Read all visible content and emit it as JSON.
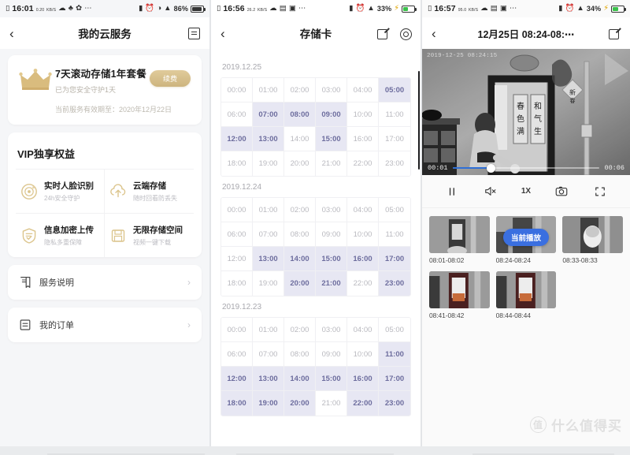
{
  "panels": [
    {
      "id": "cloud-service",
      "status": {
        "time": "16:01",
        "net_top": "0.20",
        "net_bot": "KB/S",
        "battery_pct": "86%",
        "icons": [
          "alarm-icon",
          "dnd-icon",
          "wifi-icon"
        ]
      },
      "nav": {
        "back": "‹",
        "title": "我的云服务",
        "right_icon": "list-box-icon"
      },
      "plan": {
        "title": "7天滚动存储1年套餐",
        "subtitle": "已为您安全守护1天",
        "renew_label": "续费",
        "expire": "当前服务有效期至：2020年12月22日",
        "accent": "#cdb47e"
      },
      "vip": {
        "title": "VIP独享权益",
        "items": [
          {
            "icon": "face-recognition-icon",
            "title": "实时人脸识别",
            "sub": "24h安全守护"
          },
          {
            "icon": "cloud-upload-icon",
            "title": "云端存储",
            "sub": "随时回看防丢失"
          },
          {
            "icon": "shield-check-icon",
            "title": "信息加密上传",
            "sub": "隐私多重保障"
          },
          {
            "icon": "storage-card-icon",
            "title": "无限存储空间",
            "sub": "视频一键下载"
          }
        ]
      },
      "rows": [
        {
          "icon": "document-icon",
          "label": "服务说明",
          "chevron": "›"
        },
        {
          "icon": "order-icon",
          "label": "我的订单",
          "chevron": "›"
        }
      ]
    },
    {
      "id": "storage-card",
      "status": {
        "time": "16:56",
        "net_top": "26.2",
        "net_bot": "KB/S",
        "battery_pct": "33%",
        "icons": [
          "alarm-icon",
          "wifi-icon",
          "charging-icon"
        ]
      },
      "nav": {
        "back": "‹",
        "title": "存储卡",
        "right_icons": [
          "edit-icon",
          "gear-icon"
        ]
      },
      "hour_labels": [
        "00:00",
        "01:00",
        "02:00",
        "03:00",
        "04:00",
        "05:00",
        "06:00",
        "07:00",
        "08:00",
        "09:00",
        "10:00",
        "11:00",
        "12:00",
        "13:00",
        "14:00",
        "15:00",
        "16:00",
        "17:00",
        "18:00",
        "19:00",
        "20:00",
        "21:00",
        "22:00",
        "23:00"
      ],
      "days": [
        {
          "date": "2019.12.25",
          "active_hours": [
            "05:00",
            "07:00",
            "08:00",
            "09:00",
            "12:00",
            "13:00",
            "15:00"
          ]
        },
        {
          "date": "2019.12.24",
          "active_hours": [
            "13:00",
            "14:00",
            "15:00",
            "16:00",
            "17:00",
            "20:00",
            "21:00",
            "23:00"
          ]
        },
        {
          "date": "2019.12.23",
          "active_hours": [
            "11:00",
            "12:00",
            "13:00",
            "14:00",
            "15:00",
            "16:00",
            "17:00",
            "18:00",
            "19:00",
            "20:00",
            "22:00",
            "23:00"
          ]
        }
      ],
      "colors": {
        "active_bg": "#e7e7f3",
        "active_text": "#6d6d9e",
        "idle_text": "#b9b9bf"
      }
    },
    {
      "id": "playback",
      "status": {
        "time": "16:57",
        "net_top": "95.0",
        "net_bot": "KB/S",
        "battery_pct": "34%",
        "icons": [
          "alarm-icon",
          "wifi-icon",
          "charging-icon"
        ]
      },
      "nav": {
        "back": "‹",
        "title": "12月25日 08:24-08:⋯",
        "right_icon": "edit-icon"
      },
      "video": {
        "overlay_timestamp": "2019-12-25 08:24:15",
        "current_time": "00:01",
        "total_time": "00:06",
        "progress_pct": 26
      },
      "controls": [
        {
          "icon": "pause-icon",
          "label": ""
        },
        {
          "icon": "mute-icon",
          "label": ""
        },
        {
          "icon": "speed-icon",
          "label": "1X"
        },
        {
          "icon": "snapshot-icon",
          "label": ""
        },
        {
          "icon": "fullscreen-icon",
          "label": ""
        }
      ],
      "clips": [
        {
          "time": "08:01-08:02",
          "playing": false
        },
        {
          "time": "08:24-08:24",
          "playing": true,
          "badge": "当前播放"
        },
        {
          "time": "08:33-08:33",
          "playing": false
        },
        {
          "time": "08:41-08:42",
          "playing": false
        },
        {
          "time": "08:44-08:44",
          "playing": false
        }
      ],
      "badge_color": "#3a6fe0"
    }
  ],
  "watermark": {
    "mark": "值",
    "text": "什么值得买"
  }
}
